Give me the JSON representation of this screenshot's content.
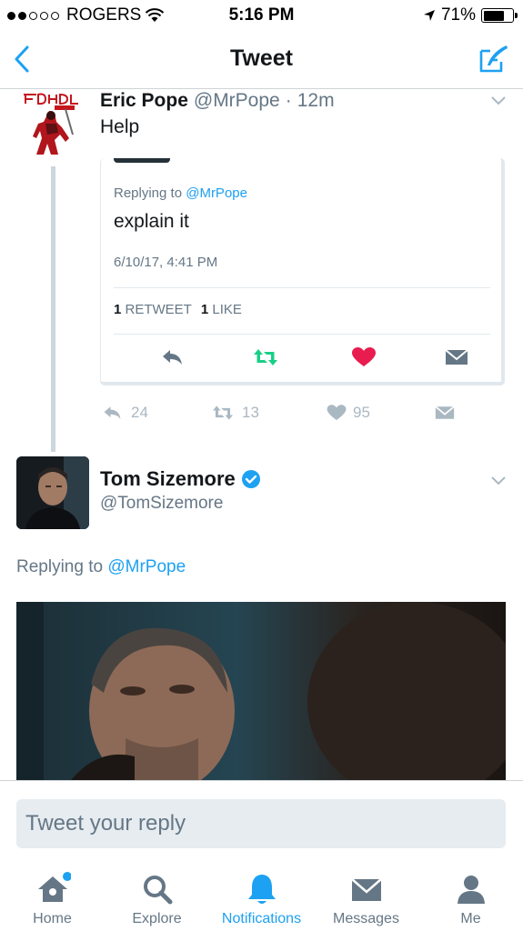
{
  "status_bar": {
    "carrier": "ROGERS",
    "time": "5:16 PM",
    "battery": "71%",
    "battery_level": 0.71,
    "signal_bars_filled": 2,
    "signal_bars_total": 5
  },
  "nav": {
    "title": "Tweet",
    "back_icon": "chevron-left-icon",
    "compose_icon": "compose-tweet-icon"
  },
  "parent_tweet": {
    "name": "Eric Pope",
    "handle": "@MrPope",
    "separator": "·",
    "age": "12m",
    "text": "Help",
    "quoted": {
      "replying_prefix": "Replying to",
      "replying_handle": "@MrPope",
      "text": "explain it",
      "date": "6/10/17, 4:41 PM",
      "retweet_count": "1",
      "retweet_label": "RETWEET",
      "like_count": "1",
      "like_label": "LIKE"
    },
    "actions": {
      "replies": "24",
      "retweets": "13",
      "likes": "95"
    }
  },
  "main_tweet": {
    "name": "Tom Sizemore",
    "handle": "@TomSizemore",
    "verified": true,
    "replying_prefix": "Replying to",
    "replying_handle": "@MrPope"
  },
  "reply_bar": {
    "placeholder": "Tweet your reply"
  },
  "tabbar": {
    "items": [
      {
        "label": "Home",
        "icon": "home-icon",
        "active": false,
        "badge": true
      },
      {
        "label": "Explore",
        "icon": "search-icon",
        "active": false
      },
      {
        "label": "Notifications",
        "icon": "bell-icon",
        "active": true
      },
      {
        "label": "Messages",
        "icon": "envelope-icon",
        "active": false
      },
      {
        "label": "Me",
        "icon": "person-icon",
        "active": false
      }
    ]
  },
  "colors": {
    "accent": "#1da1f2",
    "retweet": "#19cf86",
    "like": "#e81c4f",
    "muted": "#657786",
    "light_icon": "#aab8c2"
  }
}
